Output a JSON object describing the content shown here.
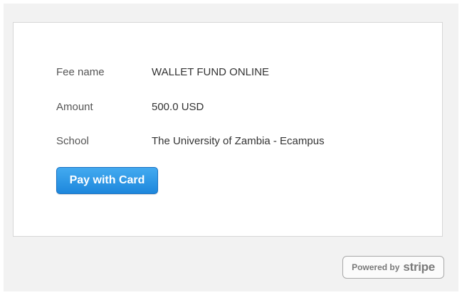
{
  "form": {
    "rows": [
      {
        "label": "Fee name",
        "value": "WALLET FUND ONLINE"
      },
      {
        "label": "Amount",
        "value": "500.0 USD"
      },
      {
        "label": "School",
        "value": "The University of Zambia - Ecampus"
      }
    ],
    "pay_button_label": "Pay with Card"
  },
  "footer": {
    "powered_by": "Powered by",
    "brand": "stripe"
  },
  "colors": {
    "button_top": "#43aaf0",
    "button_bottom": "#1d87dc",
    "background": "#f2f2f2"
  }
}
